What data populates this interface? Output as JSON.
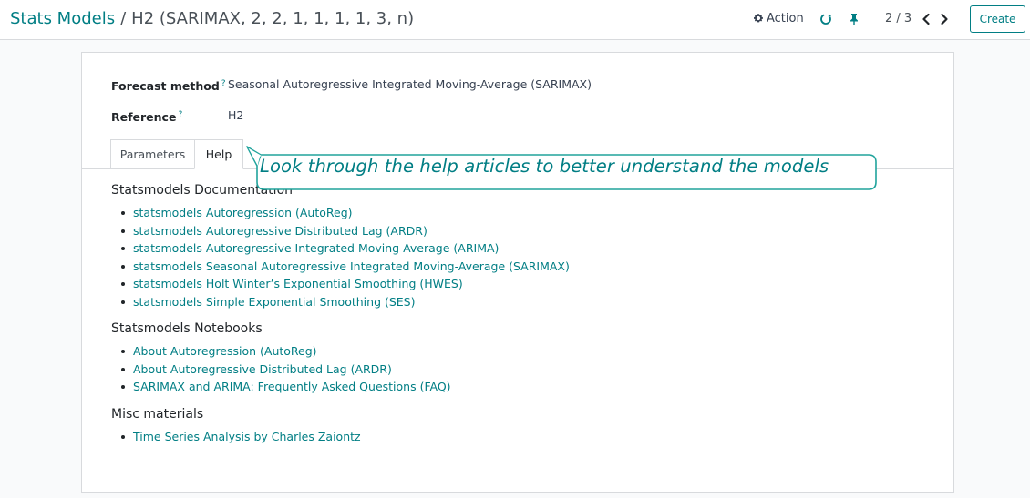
{
  "breadcrumb": {
    "parent": "Stats Models",
    "separator": "/",
    "current": "H2 (SARIMAX, 2, 2, 1, 1, 1, 1, 3, n)"
  },
  "toolbar": {
    "action_label": "Action",
    "pager": "2 / 3",
    "create_label": "Create"
  },
  "form": {
    "fields": [
      {
        "label": "Forecast method",
        "help_marker": "?",
        "value": "Seasonal Autoregressive Integrated Moving-Average (SARIMAX)"
      },
      {
        "label": "Reference",
        "help_marker": "?",
        "value": "H2"
      }
    ],
    "tabs": [
      {
        "label": "Parameters",
        "active": false
      },
      {
        "label": "Help",
        "active": true
      }
    ]
  },
  "help": {
    "sections": [
      {
        "title": "Statsmodels Documentation",
        "links": [
          "statsmodels Autoregression (AutoReg)",
          "statsmodels Autoregressive Distributed Lag (ARDR)",
          "statsmodels Autoregressive Integrated Moving Average (ARIMA)",
          "statsmodels Seasonal Autoregressive Integrated Moving-Average (SARIMAX)",
          "statsmodels Holt Winter’s Exponential Smoothing (HWES)",
          "statsmodels Simple Exponential Smoothing (SES)"
        ]
      },
      {
        "title": "Statsmodels Notebooks",
        "links": [
          "About Autoregression (AutoReg)",
          "About Autoregressive Distributed Lag (ARDR)",
          "SARIMAX and ARIMA: Frequently Asked Questions (FAQ)"
        ]
      },
      {
        "title": "Misc materials",
        "links": [
          "Time Series Analysis by Charles Zaiontz"
        ]
      }
    ]
  },
  "callout": {
    "text": "Look through the help articles to better understand the models"
  },
  "icons": {
    "action": "gear-icon",
    "sync": "refresh-icon",
    "pin": "pin-icon",
    "prev": "chevron-left-icon",
    "next": "chevron-right-icon"
  },
  "colors": {
    "accent": "#017e84",
    "text": "#212529",
    "border": "#d8dadd",
    "background": "#f9fafb"
  }
}
